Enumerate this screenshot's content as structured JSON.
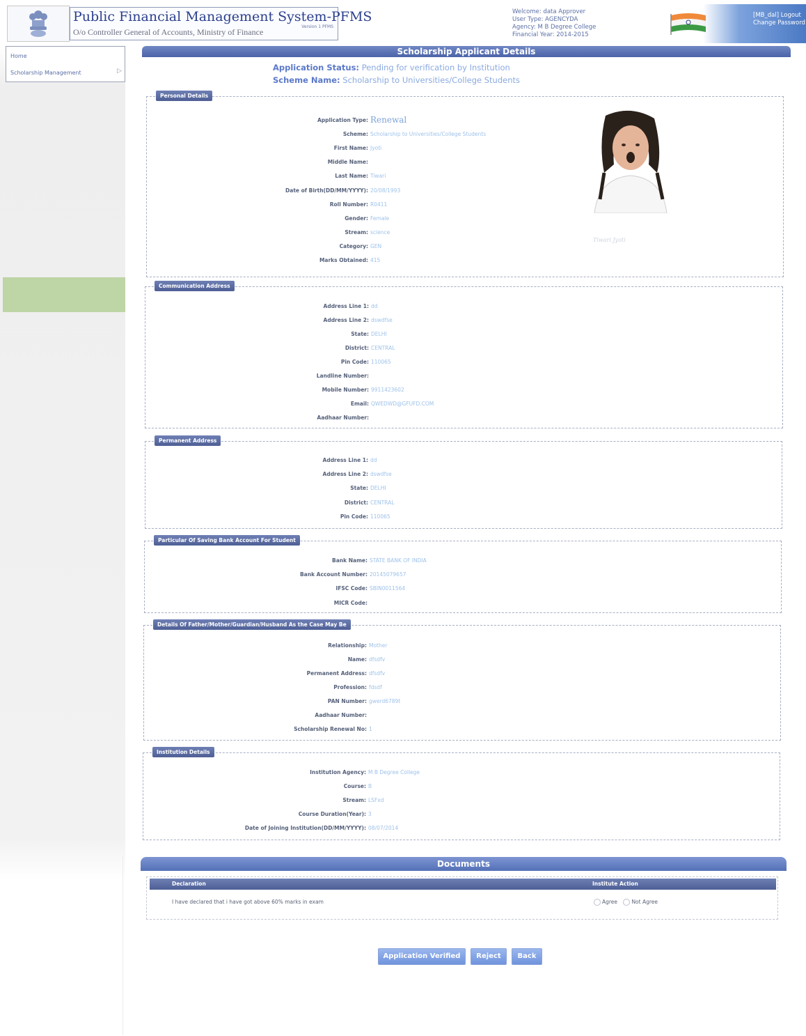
{
  "header": {
    "title": "Public Financial Management System-PFMS",
    "subtitle": "O/o Controller General of Accounts, Ministry of Finance",
    "version": "Version 1 PFMS",
    "user_info": {
      "welcome": "Welcome: data Approver",
      "user_type": "User Type: AGENCYDA",
      "agency": "Agency: M B Degree College",
      "financial_year": "Financial Year: 2014-2015"
    },
    "logout": "[MB_dal] Logout",
    "change_password": "Change Password"
  },
  "nav": {
    "items": [
      "Home",
      "Scholarship Management"
    ]
  },
  "main": {
    "page_title": "Scholarship Applicant Details",
    "application_status_label": "Application Status:",
    "application_status_value": "Pending for verification by Institution",
    "scheme_name_label": "Scheme Name:",
    "scheme_name_value": "Scholarship to Universities/College Students"
  },
  "sections": {
    "personal": {
      "title": "Personal Details",
      "fields": [
        {
          "label": "Application Type:",
          "value": "Renewal"
        },
        {
          "label": "Scheme:",
          "value": "Scholarship to Universities/College Students"
        },
        {
          "label": "First Name:",
          "value": "Jyoti"
        },
        {
          "label": "Middle Name:",
          "value": ""
        },
        {
          "label": "Last Name:",
          "value": "Tiwari"
        },
        {
          "label": "Date of Birth(DD/MM/YYYY):",
          "value": "20/08/1993"
        },
        {
          "label": "Roll Number:",
          "value": "R0411"
        },
        {
          "label": "Gender:",
          "value": "Female"
        },
        {
          "label": "Stream:",
          "value": "science"
        },
        {
          "label": "Category:",
          "value": "GEN"
        },
        {
          "label": "Marks Obtained:",
          "value": "415"
        }
      ],
      "signature": "Tiwari Jyoti"
    },
    "communication": {
      "title": "Communication Address",
      "fields": [
        {
          "label": "Address Line 1:",
          "value": "dd"
        },
        {
          "label": "Address Line 2:",
          "value": "dswdfse"
        },
        {
          "label": "State:",
          "value": "DELHI"
        },
        {
          "label": "District:",
          "value": "CENTRAL"
        },
        {
          "label": "Pin Code:",
          "value": "110065"
        },
        {
          "label": "Landline Number:",
          "value": ""
        },
        {
          "label": "Mobile Number:",
          "value": "9911423602"
        },
        {
          "label": "Email:",
          "value": "QWEDWD@GFUFD.COM"
        },
        {
          "label": "Aadhaar Number:",
          "value": ""
        }
      ]
    },
    "permanent": {
      "title": "Permanent Address",
      "fields": [
        {
          "label": "Address Line 1:",
          "value": "dd"
        },
        {
          "label": "Address Line 2:",
          "value": "dswdfse"
        },
        {
          "label": "State:",
          "value": "DELHI"
        },
        {
          "label": "District:",
          "value": "CENTRAL"
        },
        {
          "label": "Pin Code:",
          "value": "110065"
        }
      ]
    },
    "bank": {
      "title": "Particular Of Saving Bank Account For Student",
      "fields": [
        {
          "label": "Bank Name:",
          "value": "STATE BANK OF INDIA"
        },
        {
          "label": "Bank Account Number:",
          "value": "20145079657"
        },
        {
          "label": "IFSC Code:",
          "value": "SBIN0011564"
        },
        {
          "label": "MICR Code:",
          "value": ""
        }
      ]
    },
    "guardian": {
      "title": "Details Of Father/Mother/Guardian/Husband As the Case May Be",
      "fields": [
        {
          "label": "Relationship:",
          "value": "Mother"
        },
        {
          "label": "Name:",
          "value": "dfsdfv"
        },
        {
          "label": "Permanent Address:",
          "value": "dfsdfv"
        },
        {
          "label": "Profession:",
          "value": "fdsdf"
        },
        {
          "label": "PAN Number:",
          "value": "gwerd6789t"
        },
        {
          "label": "Aadhaar Number:",
          "value": ""
        },
        {
          "label": "Scholarship Renewal No:",
          "value": "1"
        }
      ]
    },
    "institution": {
      "title": "Institution Details",
      "fields": [
        {
          "label": "Institution Agency:",
          "value": "M B Degree College"
        },
        {
          "label": "Course:",
          "value": "B"
        },
        {
          "label": "Stream:",
          "value": "LSFxd"
        },
        {
          "label": "Course Duration(Year):",
          "value": "3"
        },
        {
          "label": "Date of Joining Institution(DD/MM/YYYY):",
          "value": "08/07/2014"
        }
      ]
    }
  },
  "documents": {
    "title": "Documents",
    "col_declaration": "Declaration",
    "col_action": "Institute Action",
    "declaration_text": "I have declared that i have got above 60% marks in exam",
    "agree": "Agree",
    "not_agree": "Not Agree"
  },
  "buttons": {
    "verify": "Application Verified",
    "reject": "Reject",
    "back": "Back"
  },
  "colors": {
    "title_bar": "#4b63a8",
    "label": "#55607a",
    "value": "#9ec2ea",
    "status_key": "#5b79c8",
    "button": "#6f93dc",
    "left_green": "#bed5a6"
  }
}
